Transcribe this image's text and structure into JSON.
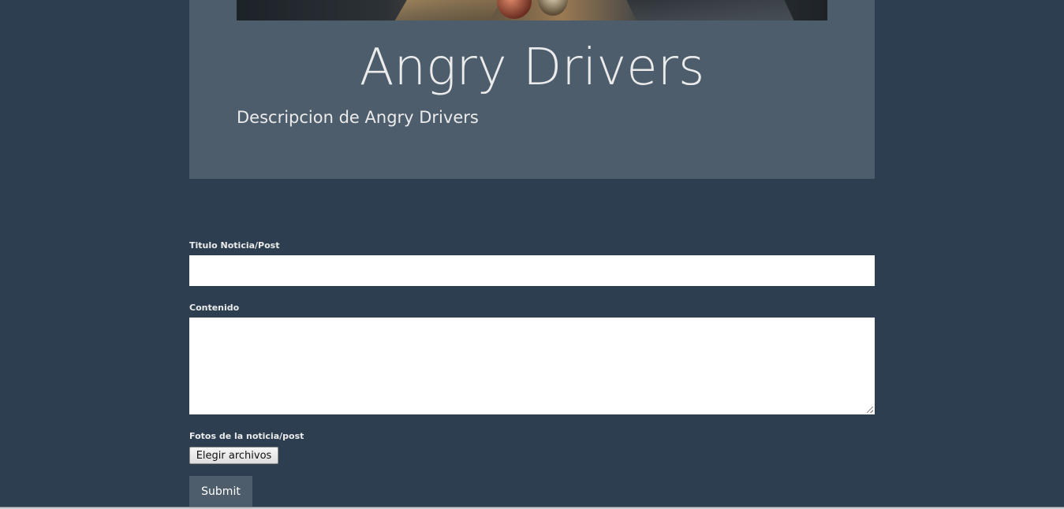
{
  "header": {
    "title": "Angry Drivers",
    "description": "Descripcion de Angry Drivers"
  },
  "form": {
    "title_label": "Titulo Noticia/Post",
    "title_value": "",
    "content_label": "Contenido",
    "content_value": "",
    "photos_label": "Fotos de la noticia/post",
    "file_button_label": "Elegir archivos",
    "submit_label": "Submit"
  },
  "colors": {
    "background": "#2c3e50",
    "header_card": "#4e5d6c",
    "text": "#ebebeb",
    "submit_bg": "#4e5d6c"
  }
}
